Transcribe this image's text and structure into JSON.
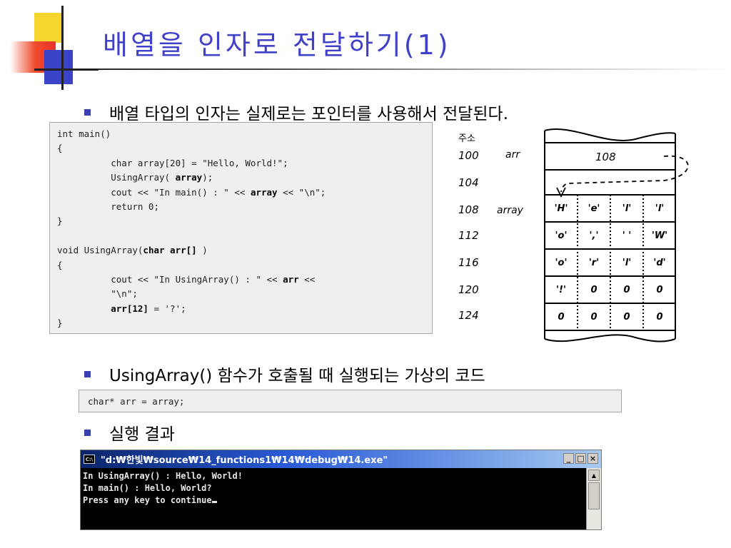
{
  "title": "배열을 인자로 전달하기(1)",
  "bullets": [
    "배열 타입의 인자는 실제로는 포인터를 사용해서 전달된다.",
    "UsingArray() 함수가 호출될 때 실행되는 가상의 코드",
    "실행 결과"
  ],
  "code_main": [
    "int main()",
    "{",
    "          char array[20] = \"Hello, World!\";",
    "          UsingArray( ",
    "          cout << \"In main() : \" << ",
    "          return 0;",
    "}",
    "",
    "void UsingArray(",
    "{",
    "          cout << \"In UsingArray() : \" << ",
    "          \"\\n\";",
    "          ",
    "}"
  ],
  "code_bold": {
    "array": "array",
    "close_call": ");",
    "after_array": " << \"\\n\";",
    "char_arr": "char arr[]",
    "close_paren": " )",
    "arr": "arr",
    "after_arr": " <<",
    "arr12": "arr[12]",
    "assign": " = '?';"
  },
  "code_alias": "char* arr = array;",
  "memory": {
    "header": "주소",
    "addresses": [
      "100",
      "104",
      "108",
      "112",
      "116",
      "120",
      "124"
    ],
    "arr_label": "arr",
    "array_label": "array",
    "arr_value": "108",
    "cells": [
      [
        "'H'",
        "'e'",
        "'l'",
        "'l'"
      ],
      [
        "'o'",
        "','",
        "' '",
        "'W'"
      ],
      [
        "'o'",
        "'r'",
        "'l'",
        "'d'"
      ],
      [
        "'!'",
        "0",
        "0",
        "0"
      ],
      [
        "0",
        "0",
        "0",
        "0"
      ]
    ]
  },
  "console": {
    "title": "\"d:₩한빛₩source₩14_functions1₩14₩debug₩14.exe\"",
    "icon": "C:\\",
    "lines": [
      "In UsingArray() : Hello, World!",
      "In main() : Hello, World?",
      "Press any key to continue"
    ],
    "buttons": [
      "_",
      "□",
      "×"
    ]
  }
}
